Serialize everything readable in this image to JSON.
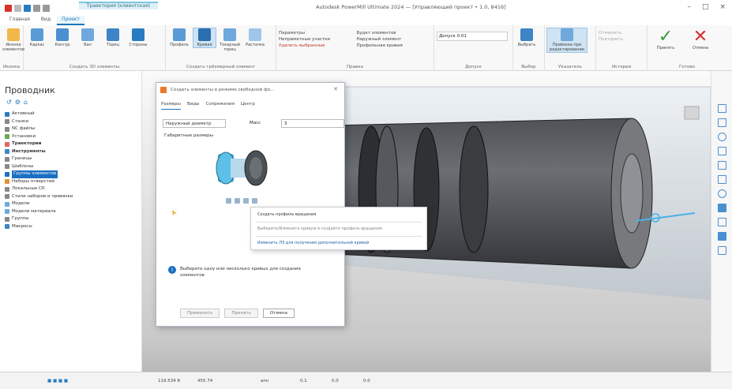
{
  "window": {
    "ctx_tab": "Траектория (клиентская)",
    "title": "Autodesk PowerMill Ultimate 2024 — [Управляющий проект • 1.0, 8416]",
    "controls": [
      "–",
      "□",
      "×"
    ]
  },
  "tabs": [
    "Главная",
    "Вид",
    "Проект"
  ],
  "ribbon": {
    "groups": [
      {
        "label": "Иконка",
        "buttons": [
          "Иконка элементов"
        ]
      },
      {
        "label": "Создать 3D элементы",
        "buttons": [
          "Каркас",
          "Контур",
          "Вал",
          "Торец",
          "Стороны"
        ]
      },
      {
        "label": "Создать трёхмерный элемент",
        "buttons": [
          "Профиль",
          "Кривая",
          "Токарный торец",
          "Растачка"
        ]
      },
      {
        "label": "Правка",
        "items": [
          "Параметры",
          "Удалить выбранные",
          "Неприметные участки",
          "Профильная кривая",
          "Будет элементов",
          "Наружный элемент"
        ]
      },
      {
        "label": "Допуск",
        "field": "Допуск 0.01"
      },
      {
        "label": "Выбор",
        "buttons": [
          "Выбрать"
        ]
      },
      {
        "label": "Указатель",
        "buttons": [
          "Привязка при редактировании"
        ]
      },
      {
        "label": "История",
        "items": [
          "Отменить",
          "Повторить"
        ]
      },
      {
        "label": "Готово",
        "buttons": [
          "Принять",
          "Отмена"
        ]
      }
    ]
  },
  "explorer": {
    "title": "Проводник",
    "tree": [
      {
        "label": "Активный",
        "bold": false,
        "icon": "#2a7cc2"
      },
      {
        "label": "Станки",
        "bold": false,
        "icon": "#888888"
      },
      {
        "label": "NC файлы",
        "bold": false,
        "icon": "#888888"
      },
      {
        "label": "Установки",
        "bold": false,
        "icon": "#6aa84f"
      },
      {
        "label": "Траектории",
        "bold": true,
        "icon": "#e06666"
      },
      {
        "label": "Инструменты",
        "bold": true,
        "icon": "#3d85c6"
      },
      {
        "label": "Границы",
        "bold": false,
        "icon": "#888888"
      },
      {
        "label": "Шаблоны",
        "bold": false,
        "icon": "#888888"
      },
      {
        "label": "Группы элементов",
        "bold": false,
        "icon": "#1b6fc2",
        "highlight": true
      },
      {
        "label": "Наборы отверстий",
        "bold": false,
        "icon": "#e69138"
      },
      {
        "label": "Локальные СК",
        "bold": false,
        "icon": "#888888"
      },
      {
        "label": "Стили наборов и привязки",
        "bold": false,
        "icon": "#888888"
      },
      {
        "label": "Модели",
        "bold": false,
        "icon": "#6fa8dc"
      },
      {
        "label": "Модели материала",
        "bold": false,
        "icon": "#6fa8dc"
      },
      {
        "label": "Группы",
        "bold": false,
        "icon": "#888888"
      },
      {
        "label": "Макросы",
        "bold": false,
        "icon": "#3d85c6"
      }
    ]
  },
  "dialog": {
    "title": "Создать элементы в режиме свободной фо...",
    "tabs": [
      "Размеры",
      "Виды",
      "Сопряжения",
      "Центр"
    ],
    "type_value": "Наружный диаметр",
    "mass_label": "Масс",
    "mass_value": "3",
    "sub_label": "Габаритные размеры",
    "info": "Выберите одну или несколько кривых для создания элементов",
    "buttons": {
      "apply": "Применить",
      "accept": "Принять",
      "cancel": "Отмена"
    }
  },
  "context_menu": {
    "items": [
      "Создать профиль вращения",
      "Выберите/Измените кривую в создайте профиль вращения",
      "Изменить ЛЗ для получения дополнительной кривой"
    ]
  },
  "status": {
    "coords": "119.534 8",
    "value2": "455.74",
    "tools": [
      "ann",
      "0.1",
      "0.0",
      "0.0"
    ]
  },
  "colors": {
    "accent": "#1b75bb",
    "ok": "#3c9a3c",
    "cancel": "#d2322d"
  }
}
